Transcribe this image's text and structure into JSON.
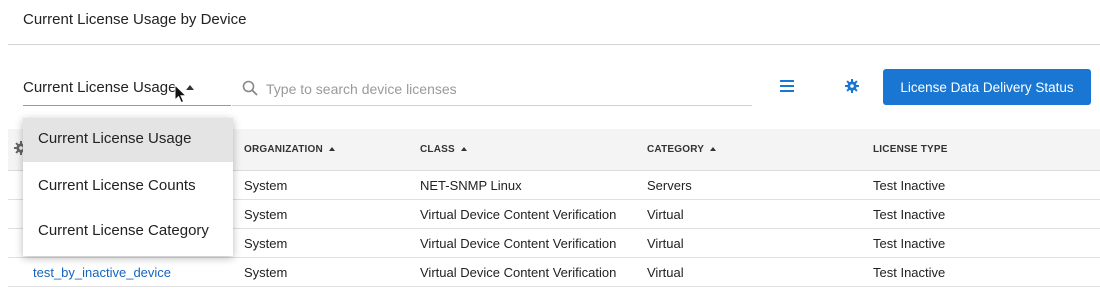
{
  "page": {
    "title": "Current License Usage by Device"
  },
  "toolbar": {
    "view_select": {
      "value": "Current License Usage"
    },
    "search": {
      "placeholder": "Type to search device licenses",
      "value": ""
    },
    "delivery_button_label": "License Data Delivery Status"
  },
  "dropdown": {
    "options": [
      {
        "label": "Current License Usage",
        "selected": true
      },
      {
        "label": "Current License Counts",
        "selected": false
      },
      {
        "label": "Current License Category",
        "selected": false
      }
    ]
  },
  "table": {
    "columns": [
      {
        "label": "ORGANIZATION",
        "sorted": "asc"
      },
      {
        "label": "CLASS",
        "sorted": "asc"
      },
      {
        "label": "CATEGORY",
        "sorted": "asc"
      },
      {
        "label": "LICENSE TYPE",
        "sorted": null
      }
    ],
    "rows": [
      {
        "device": "",
        "organization": "System",
        "class": "NET-SNMP Linux",
        "category": "Servers",
        "license_type": "Test Inactive"
      },
      {
        "device": "",
        "organization": "System",
        "class": "Virtual Device Content Verification",
        "category": "Virtual",
        "license_type": "Test Inactive"
      },
      {
        "device": "test_by_inactive_device",
        "organization": "System",
        "class": "Virtual Device Content Verification",
        "category": "Virtual",
        "license_type": "Test Inactive"
      },
      {
        "device": "test_by_inactive_device",
        "organization": "System",
        "class": "Virtual Device Content Verification",
        "category": "Virtual",
        "license_type": "Test Inactive"
      }
    ]
  },
  "colors": {
    "accent": "#1976d2",
    "link": "#1565c0"
  },
  "icons": [
    "search-icon",
    "list-view-icon",
    "settings-icon",
    "cursor-icon"
  ]
}
